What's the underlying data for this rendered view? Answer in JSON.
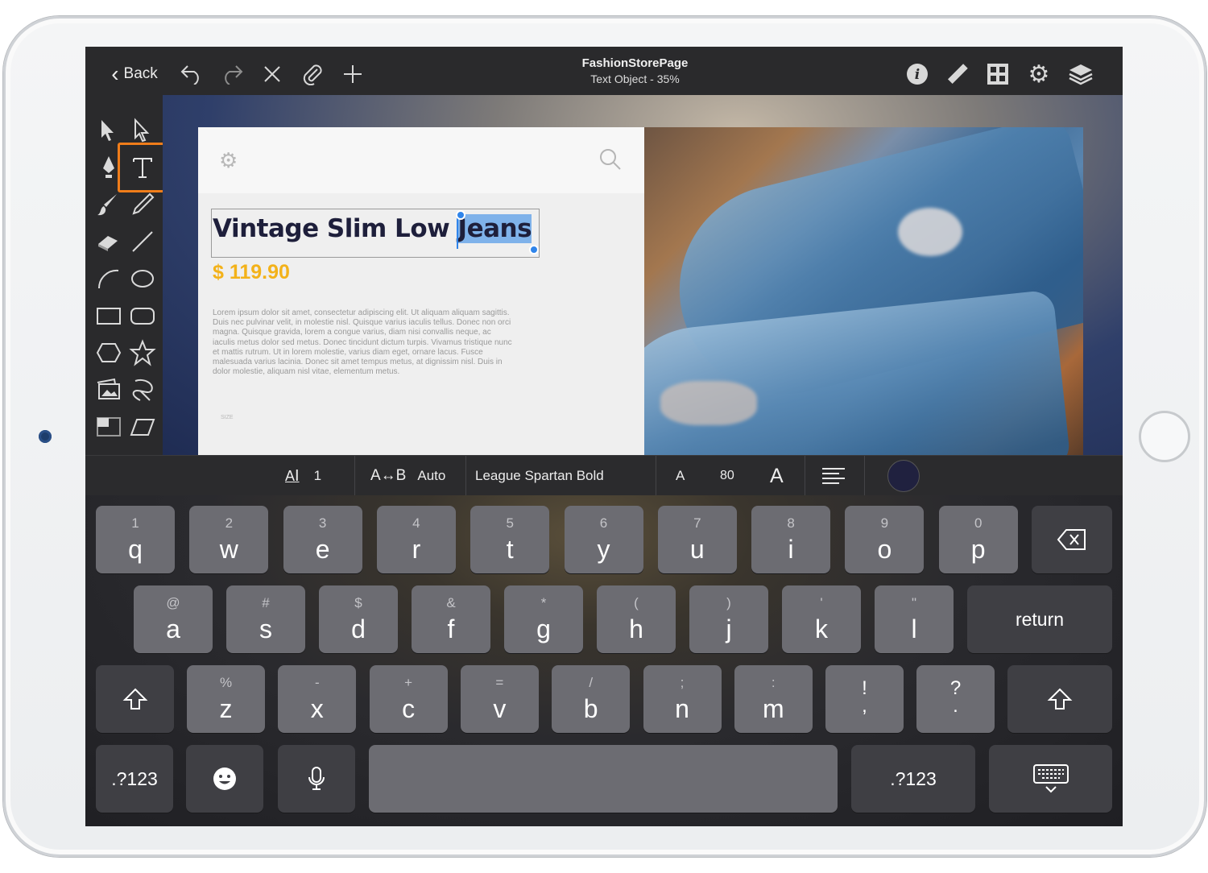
{
  "document": {
    "title": "FashionStorePage",
    "subtitle": "Text Object - 35%"
  },
  "toolbar": {
    "back_label": "Back",
    "left_icons": [
      "undo-icon",
      "redo-icon",
      "close-icon",
      "paperclip-icon",
      "plus-icon"
    ],
    "right_icons": [
      "info-icon",
      "ruler-icon",
      "grid-icon",
      "gear-icon",
      "layers-icon"
    ]
  },
  "tools": [
    "select-arrow-icon",
    "direct-select-arrow-icon",
    "pen-icon",
    "text-tool-icon",
    "brush-icon",
    "pencil-icon",
    "eraser-icon",
    "line-icon",
    "arc-icon",
    "ellipse-icon",
    "rectangle-icon",
    "rounded-rectangle-icon",
    "hexagon-icon",
    "star-icon",
    "image-icon",
    "lasso-icon",
    "frame-icon",
    "parallelogram-icon"
  ],
  "active_tool": "text-tool-icon",
  "artboard": {
    "headline_plain": "Vintage Slim Low ",
    "headline_selected": "Jeans",
    "price": "$ 119.90",
    "body": "Lorem ipsum dolor sit amet, consectetur adipiscing elit. Ut aliquam aliquam sagittis. Duis nec pulvinar velit, in molestie nisl. Quisque varius iaculis tellus. Donec non orci magna. Quisque gravida, lorem a congue varius, diam nisi convallis neque, ac iaculis metus dolor sed metus. Donec tincidunt dictum turpis. Vivamus tristique nunc et mattis rutrum. Ut in lorem molestie, varius diam eget, ornare lacus. Fusce malesuada varius lacinia. Donec sit amet tempus metus, at dignissim nisl. Duis in dolor molestie, aliquam nisl vitae, elementum metus.",
    "size_label": "SIZE",
    "header_icons": [
      "gear-icon",
      "search-icon"
    ]
  },
  "format_bar": {
    "line_spacing_value": "1",
    "letter_spacing_label": "A↔B",
    "letter_spacing_value": "Auto",
    "font_name": "League Spartan Bold",
    "font_size_small_label": "A",
    "font_size": "80",
    "font_size_large_label": "A",
    "text_color": "#20213f"
  },
  "keyboard": {
    "row1": [
      {
        "sub": "1",
        "key": "q"
      },
      {
        "sub": "2",
        "key": "w"
      },
      {
        "sub": "3",
        "key": "e"
      },
      {
        "sub": "4",
        "key": "r"
      },
      {
        "sub": "5",
        "key": "t"
      },
      {
        "sub": "6",
        "key": "y"
      },
      {
        "sub": "7",
        "key": "u"
      },
      {
        "sub": "8",
        "key": "i"
      },
      {
        "sub": "9",
        "key": "o"
      },
      {
        "sub": "0",
        "key": "p"
      }
    ],
    "row2": [
      {
        "sub": "@",
        "key": "a"
      },
      {
        "sub": "#",
        "key": "s"
      },
      {
        "sub": "$",
        "key": "d"
      },
      {
        "sub": "&",
        "key": "f"
      },
      {
        "sub": "*",
        "key": "g"
      },
      {
        "sub": "(",
        "key": "h"
      },
      {
        "sub": ")",
        "key": "j"
      },
      {
        "sub": "'",
        "key": "k"
      },
      {
        "sub": "\"",
        "key": "l"
      }
    ],
    "row3": [
      {
        "sub": "%",
        "key": "z"
      },
      {
        "sub": "-",
        "key": "x"
      },
      {
        "sub": "+",
        "key": "c"
      },
      {
        "sub": "=",
        "key": "v"
      },
      {
        "sub": "/",
        "key": "b"
      },
      {
        "sub": ";",
        "key": "n"
      },
      {
        "sub": ":",
        "key": "m"
      }
    ],
    "punct1_top": "!",
    "punct1_bottom": ",",
    "punct2_top": "?",
    "punct2_bottom": ".",
    "return_label": "return",
    "numbers_label": ".?123"
  },
  "colors": {
    "accent_orange": "#f07d1a",
    "selection_blue": "#2f84ea",
    "price_yellow": "#f3b21a",
    "headline_navy": "#1e1f3b"
  }
}
